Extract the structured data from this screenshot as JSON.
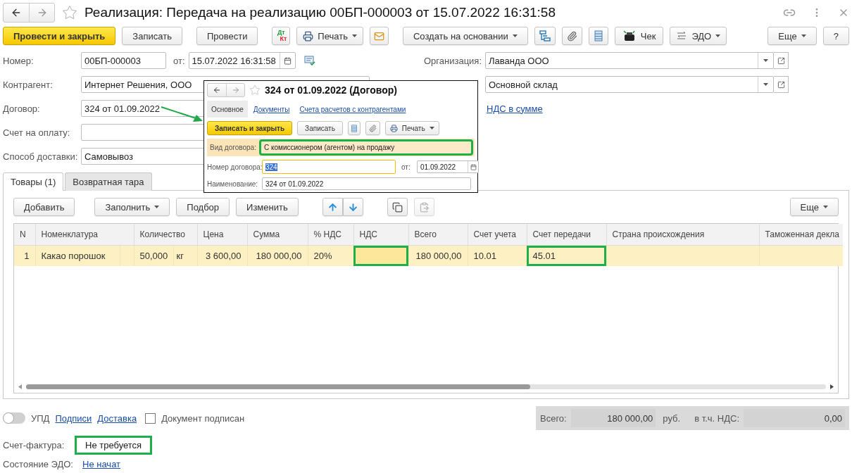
{
  "window": {
    "title": "Реализация: Передача на реализацию 00БП-000003 от 15.07.2022 16:31:58"
  },
  "toolbar": {
    "groups": [
      [
        {
          "kind": "primary",
          "label": "Провести и закрыть"
        },
        {
          "kind": "button",
          "label": "Записать"
        }
      ],
      [
        {
          "kind": "button",
          "label": "Провести"
        }
      ],
      [
        {
          "kind": "dtkt",
          "debit": "Дт",
          "credit": "Кт"
        },
        {
          "kind": "print",
          "label": "Печать"
        },
        {
          "kind": "mail"
        }
      ],
      [
        {
          "kind": "menu",
          "label": "Создать на основании"
        },
        {
          "kind": "structure"
        },
        {
          "kind": "clip"
        },
        {
          "kind": "list"
        },
        {
          "kind": "receipt",
          "label": "Чек"
        },
        {
          "kind": "edo",
          "label": "ЭДО"
        }
      ]
    ],
    "right": [
      {
        "kind": "menu",
        "label": "Еще"
      },
      {
        "kind": "button",
        "label": "?"
      }
    ]
  },
  "form": {
    "number": {
      "label": "Номер:",
      "value": "00БП-000003"
    },
    "date": {
      "label": "от:",
      "value": "15.07.2022 16:31:58"
    },
    "fields": [
      {
        "label": "Контрагент:",
        "value": "Интернет Решения, ООО"
      },
      {
        "label": "Договор:",
        "value": "324 от 01.09.2022"
      },
      {
        "label": "Счет на оплату:"
      },
      {
        "label": "Способ доставки:",
        "value": "Самовывоз"
      }
    ],
    "organization": {
      "label": "Организация:",
      "value": "Лаванда ООО"
    },
    "warehouse": {
      "value": "Основной склад"
    },
    "vat_link": "НДС в сумме"
  },
  "tabs": [
    {
      "label": "Товары (1)",
      "selected": true
    },
    {
      "label": "Возвратная тара",
      "selected": false
    }
  ],
  "table_toolbar": {
    "buttons": [
      {
        "kind": "button",
        "label": "Добавить"
      },
      {
        "kind": "menu",
        "label": "Заполнить"
      },
      {
        "kind": "button",
        "label": "Подбор"
      },
      {
        "kind": "button",
        "label": "Изменить"
      }
    ],
    "more": "Еще"
  },
  "table": {
    "columns": [
      "N",
      "Номенклатура",
      "Количество",
      "Цена",
      "Сумма",
      "% НДС",
      "НДС",
      "Всего",
      "Счет учета",
      "Счет передачи",
      "Страна происхождения",
      "Таможенная декла"
    ],
    "rows": [
      {
        "selected": true,
        "n": "1",
        "nomenclature": "Какао порошок",
        "quantity": "50,000",
        "unit": "кг",
        "price": "3 600,00",
        "sum": "180 000,00",
        "vat_rate": "20%",
        "vat": {
          "highlighted": true
        },
        "total": "180 000,00",
        "account": "10.01",
        "transfer_account": {
          "value": "45.01",
          "highlighted": true
        }
      }
    ]
  },
  "footer": {
    "upd": {
      "label": "УПД",
      "on": false
    },
    "links": [
      "Подписи",
      "Доставка"
    ],
    "signed": {
      "label": "Документ подписан",
      "checked": false
    },
    "totals": {
      "total_label": "Всего:",
      "total": "180 000,00",
      "currency": "руб.",
      "vat_label": "в т.ч. НДС:",
      "vat": "0,00"
    },
    "invoice": {
      "label": "Счет-фактура:",
      "value": "Не требуется",
      "highlighted": true
    },
    "edo": {
      "label": "Состояние ЭДО:",
      "value": "Не начат"
    }
  },
  "popup": {
    "title": "324 от 01.09.2022 (Договор)",
    "tabs": [
      {
        "label": "Основное",
        "selected": true
      },
      {
        "label": "Документы",
        "selected": false
      },
      {
        "label": "Счета расчетов с контрагентами",
        "selected": false
      }
    ],
    "buttons": [
      {
        "kind": "primary",
        "label": "Записать и закрыть"
      },
      {
        "kind": "button",
        "label": "Записать"
      },
      {
        "kind": "list"
      },
      {
        "kind": "clip"
      },
      {
        "kind": "print",
        "label": "Печать"
      }
    ],
    "contract_type": {
      "label": "Вид договора:",
      "value": "С комиссионером (агентом) на продажу",
      "highlighted": true
    },
    "contract_number": {
      "label": "Номер договора:",
      "value": "324",
      "text_selected": true
    },
    "date": {
      "label": "от:",
      "value": "01.09.2022"
    },
    "name": {
      "label": "Наименование:",
      "value": "324 от 01.09.2022"
    }
  },
  "annotation": {
    "arrow": true
  }
}
